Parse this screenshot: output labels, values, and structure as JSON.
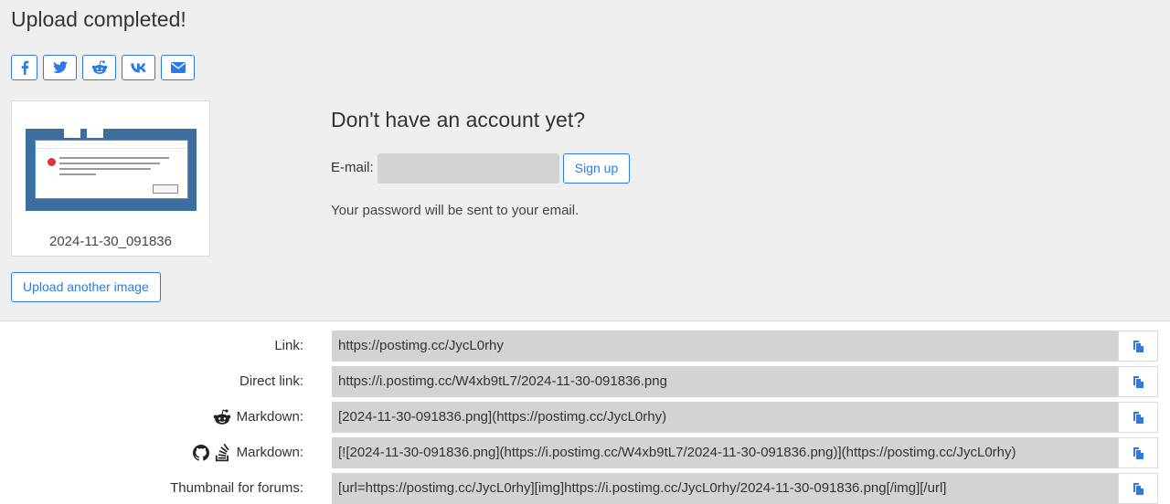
{
  "page": {
    "title": "Upload completed!"
  },
  "share": {
    "buttons": [
      {
        "icon": "facebook-icon"
      },
      {
        "icon": "twitter-icon"
      },
      {
        "icon": "reddit-icon"
      },
      {
        "icon": "vk-icon"
      },
      {
        "icon": "envelope-icon"
      }
    ]
  },
  "thumbnail": {
    "caption": "2024-11-30_091836"
  },
  "upload_another_label": "Upload another image",
  "account": {
    "title": "Don't have an account yet?",
    "email_label": "E-mail:",
    "email_value": "",
    "signup_label": "Sign up",
    "note": "Your password will be sent to your email."
  },
  "links": [
    {
      "label": "Link:",
      "icons": [],
      "value": "https://postimg.cc/JycL0rhy"
    },
    {
      "label": "Direct link:",
      "icons": [],
      "value": "https://i.postimg.cc/W4xb9tL7/2024-11-30-091836.png"
    },
    {
      "label": "Markdown:",
      "icons": [
        "reddit-icon"
      ],
      "value": "[2024-11-30-091836.png](https://postimg.cc/JycL0rhy)"
    },
    {
      "label": "Markdown:",
      "icons": [
        "github-icon",
        "stackoverflow-icon"
      ],
      "value": "[![2024-11-30-091836.png](https://i.postimg.cc/W4xb9tL7/2024-11-30-091836.png)](https://postimg.cc/JycL0rhy)"
    },
    {
      "label": "Thumbnail for forums:",
      "icons": [],
      "value": "[url=https://postimg.cc/JycL0rhy][img]https://i.postimg.cc/JycL0rhy/2024-11-30-091836.png[/img][/url]"
    }
  ],
  "colors": {
    "accent": "#2c7be5",
    "top_background": "#efefef",
    "field_background": "#d3d3d3"
  }
}
